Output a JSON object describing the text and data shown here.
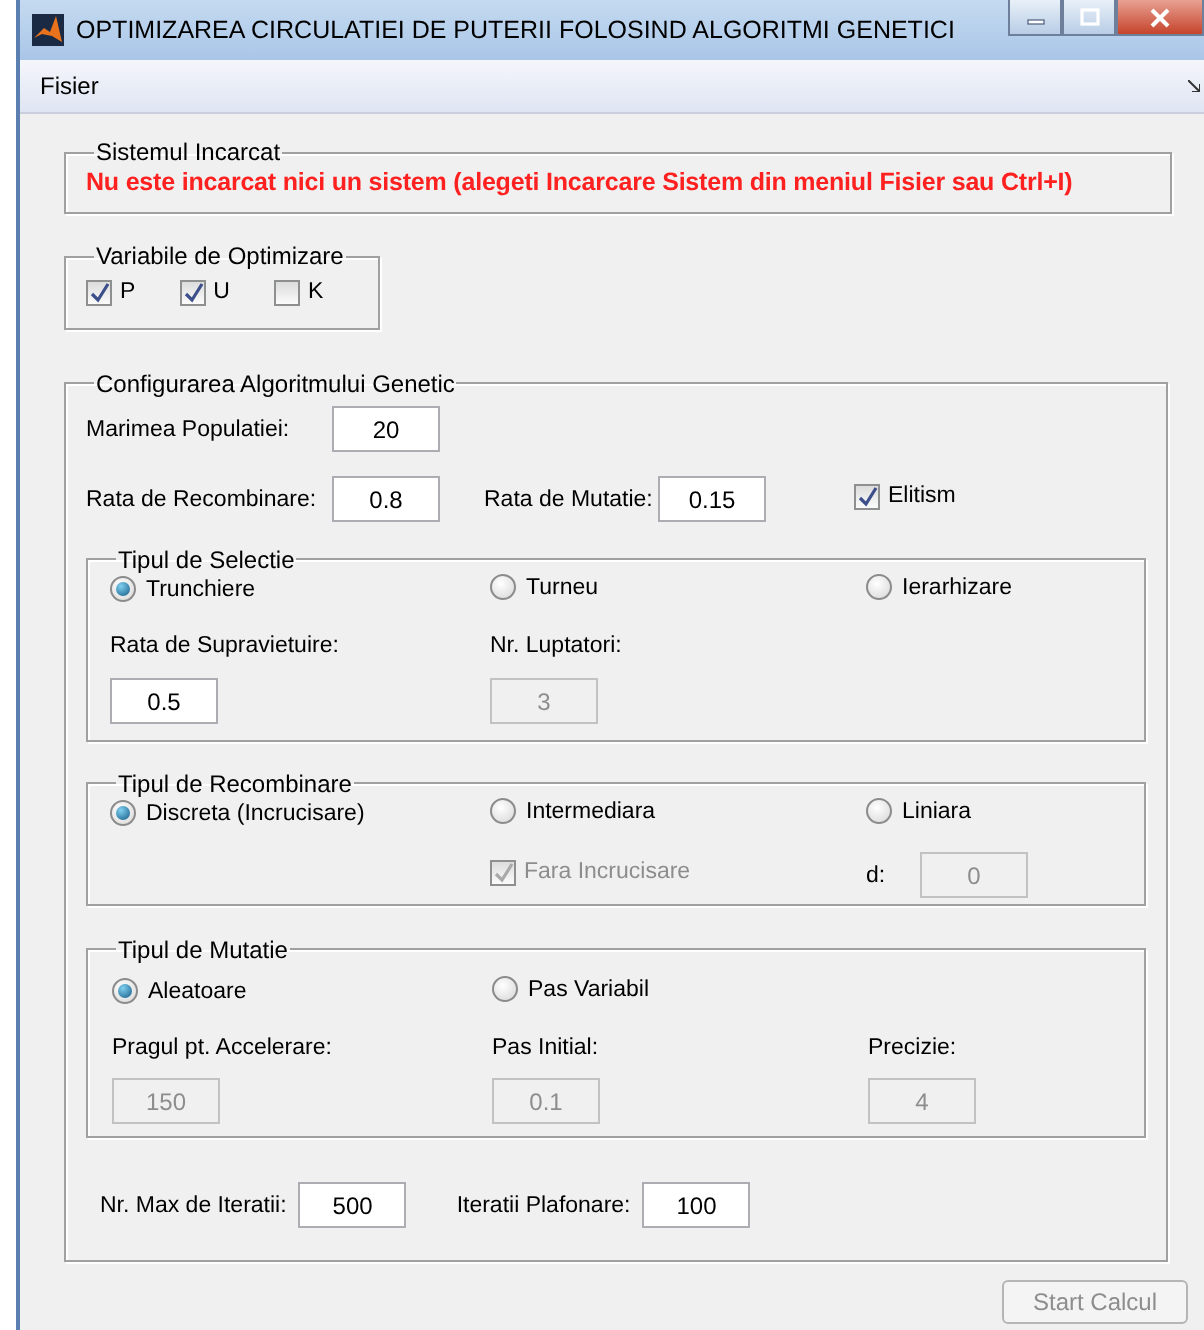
{
  "window": {
    "title": "OPTIMIZAREA CIRCULATIEI DE PUTERII FOLOSIND ALGORITMI GENETICI"
  },
  "menu": [
    {
      "label": "Fisier"
    }
  ],
  "system_group": {
    "title": "Sistemul Incarcat",
    "message": "Nu este incarcat nici un sistem (alegeti Incarcare Sistem din meniul Fisier sau Ctrl+I)"
  },
  "variables_group": {
    "title": "Variabile de Optimizare",
    "items": [
      {
        "label": "P",
        "checked": true
      },
      {
        "label": "U",
        "checked": true
      },
      {
        "label": "K",
        "checked": false
      }
    ]
  },
  "config_group": {
    "title": "Configurarea Algoritmului Genetic",
    "population": {
      "label": "Marimea Populatiei:",
      "value": "20",
      "disabled": false
    },
    "recombination_rate": {
      "label": "Rata de Recombinare:",
      "value": "0.8",
      "disabled": false
    },
    "mutation_rate": {
      "label": "Rata de Mutatie:",
      "value": "0.15",
      "disabled": false
    },
    "elitism": {
      "label": "Elitism",
      "checked": true,
      "disabled": false
    },
    "selection": {
      "title": "Tipul de Selectie",
      "options": [
        {
          "label": "Trunchiere",
          "selected": true
        },
        {
          "label": "Turneu",
          "selected": false
        },
        {
          "label": "Ierarhizare",
          "selected": false
        }
      ],
      "fields": [
        {
          "label": "Rata de Supravietuire:",
          "value": "0.5",
          "disabled": false
        },
        {
          "label": "Nr. Luptatori:",
          "value": "3",
          "disabled": true
        }
      ]
    },
    "recombination": {
      "title": "Tipul de Recombinare",
      "options": [
        {
          "label": "Discreta (Incrucisare)",
          "selected": true
        },
        {
          "label": "Intermediara",
          "selected": false
        },
        {
          "label": "Liniara",
          "selected": false
        }
      ],
      "no_crossover": {
        "label": "Fara Incrucisare",
        "checked": true,
        "disabled": true
      },
      "d": {
        "label": "d:",
        "value": "0",
        "disabled": true
      }
    },
    "mutation": {
      "title": "Tipul de Mutatie",
      "options": [
        {
          "label": "Aleatoare",
          "selected": true
        },
        {
          "label": "Pas Variabil",
          "selected": false
        }
      ],
      "fields": [
        {
          "label": "Pragul pt. Accelerare:",
          "value": "150",
          "disabled": true
        },
        {
          "label": "Pas Initial:",
          "value": "0.1",
          "disabled": true
        },
        {
          "label": "Precizie:",
          "value": "4",
          "disabled": true
        }
      ]
    },
    "iterations": [
      {
        "label": "Nr. Max de Iteratii:",
        "value": "500",
        "disabled": false
      },
      {
        "label": "Iteratii Plafonare:",
        "value": "100",
        "disabled": false
      }
    ]
  },
  "start_button": {
    "label": "Start Calcul",
    "disabled": true
  }
}
